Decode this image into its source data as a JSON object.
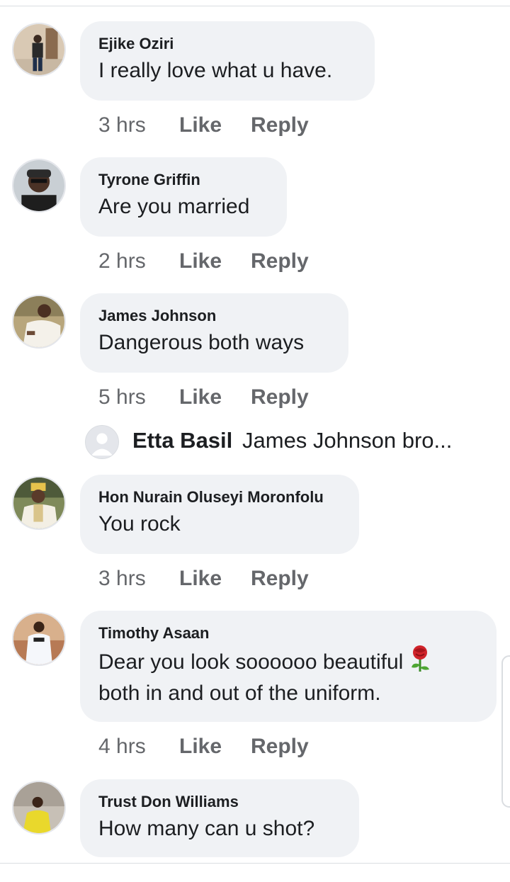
{
  "comments": [
    {
      "author": "Ejike Oziri",
      "text": "I really love what u have.",
      "time": "3 hrs",
      "like": "Like",
      "reply": "Reply"
    },
    {
      "author": "Tyrone Griffin",
      "text": "Are you married",
      "time": "2 hrs",
      "like": "Like",
      "reply": "Reply"
    },
    {
      "author": "James Johnson",
      "text": "Dangerous both ways",
      "time": "5 hrs",
      "like": "Like",
      "reply": "Reply"
    },
    {
      "author": "Hon Nurain Oluseyi Moronfolu",
      "text": "You rock",
      "time": "3 hrs",
      "like": "Like",
      "reply": "Reply"
    },
    {
      "author": "Timothy Asaan",
      "text_line1": "Dear you look soooooo beautiful",
      "text_line2": "both in and out of the uniform.",
      "emoji": "rose-emoji",
      "time": "4 hrs",
      "like": "Like",
      "reply": "Reply"
    },
    {
      "author": "Trust Don Williams",
      "text": "How many can u shot?"
    }
  ],
  "reply_preview": {
    "name": "Etta Basil",
    "text": "James Johnson bro..."
  },
  "colors": {
    "bubble": "#f0f2f5",
    "meta_text": "#65676b",
    "primary_text": "#1c1e21"
  }
}
